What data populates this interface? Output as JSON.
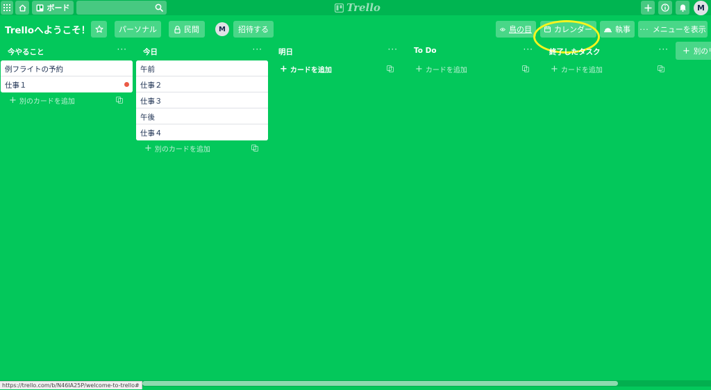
{
  "topbar": {
    "board_button_label": "ボード",
    "logo_text": "Trello",
    "avatar_initial": "M"
  },
  "board": {
    "title": "Trelloへようこそ！",
    "personal_label": "パーソナル",
    "visibility_label": "民間",
    "member_initial": "M",
    "invite_label": "招待する",
    "watch_label": "鳥の目",
    "calendar_label": "カレンダー",
    "butler_label": "執事",
    "show_menu_label": "メニューを表示"
  },
  "lists": [
    {
      "title": "今やること",
      "cards": [
        "例フライトの予約",
        "仕事１"
      ],
      "add_label": "別のカードを追加"
    },
    {
      "title": "今日",
      "cards": [
        "午前",
        "仕事２",
        "仕事３",
        "午後",
        "仕事４"
      ],
      "add_label": "別のカードを追加"
    },
    {
      "title": "明日",
      "cards": [],
      "add_label": "カードを追加"
    },
    {
      "title": "To Do",
      "cards": [],
      "add_label": "カードを追加"
    },
    {
      "title": "終了したタスク",
      "cards": [],
      "add_label": "カードを追加"
    }
  ],
  "add_list_label": "別のリ",
  "status_url": "https://trello.com/b/N46IA25P/welcome-to-trello#",
  "colors": {
    "background": "#03c85b",
    "topbar": "#00b551",
    "card_label_red": "#eb5a46",
    "highlight_circle": "#f7f51e"
  }
}
